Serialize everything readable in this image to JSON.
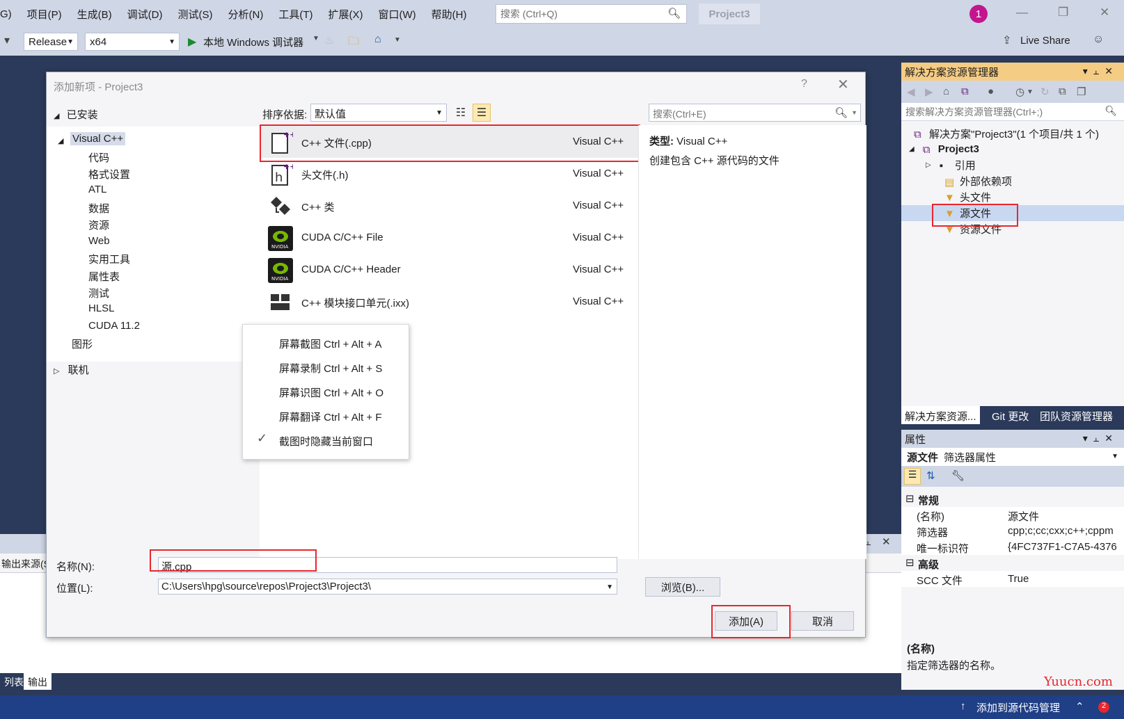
{
  "menubar": {
    "items": [
      "G)",
      "项目(P)",
      "生成(B)",
      "调试(D)",
      "测试(S)",
      "分析(N)",
      "工具(T)",
      "扩展(X)",
      "窗口(W)",
      "帮助(H)"
    ],
    "search_placeholder": "搜索 (Ctrl+Q)",
    "project_name": "Project3",
    "notification_count": "1"
  },
  "toolbar": {
    "config": "Release",
    "platform": "x64",
    "debugger": "本地 Windows 调试器",
    "live_share": "Live Share"
  },
  "dialog": {
    "title": "添加新项 - Project3",
    "help": "?",
    "installed": "已安装",
    "online": "联机",
    "tree": {
      "root": "Visual C++",
      "children": [
        "代码",
        "格式设置",
        "ATL",
        "数据",
        "资源",
        "Web",
        "实用工具",
        "属性表",
        "测试",
        "HLSL",
        "CUDA 11.2"
      ],
      "graphics": "图形"
    },
    "sort_label": "排序依据:",
    "sort_value": "默认值",
    "search_placeholder": "搜索(Ctrl+E)",
    "templates": [
      {
        "name": "C++ 文件(.cpp)",
        "lang": "Visual C++",
        "icon": "cpp-file-icon"
      },
      {
        "name": "头文件(.h)",
        "lang": "Visual C++",
        "icon": "header-file-icon"
      },
      {
        "name": "C++ 类",
        "lang": "Visual C++",
        "icon": "cpp-class-icon"
      },
      {
        "name": "CUDA C/C++ File",
        "lang": "Visual C++",
        "icon": "nvidia-icon"
      },
      {
        "name": "CUDA C/C++ Header",
        "lang": "Visual C++",
        "icon": "nvidia-icon"
      },
      {
        "name": "C++ 模块接口单元(.ixx)",
        "lang": "Visual C++",
        "icon": "module-icon"
      }
    ],
    "desc_type_label": "类型:",
    "desc_type_value": "Visual C++",
    "desc_text": "创建包含 C++ 源代码的文件",
    "name_label": "名称(N):",
    "name_value": "源.cpp",
    "location_label": "位置(L):",
    "location_value": "C:\\Users\\hpg\\source\\repos\\Project3\\Project3\\",
    "browse": "浏览(B)...",
    "add": "添加(A)",
    "cancel": "取消"
  },
  "context_menu": {
    "items": [
      "屏幕截图 Ctrl + Alt + A",
      "屏幕录制 Ctrl + Alt + S",
      "屏幕识图 Ctrl + Alt + O",
      "屏幕翻译 Ctrl + Alt + F",
      "截图时隐藏当前窗口"
    ]
  },
  "solution_explorer": {
    "title": "解决方案资源管理器",
    "search_placeholder": "搜索解决方案资源管理器(Ctrl+;)",
    "solution": "解决方案\"Project3\"(1 个项目/共 1 个)",
    "project": "Project3",
    "nodes": [
      "引用",
      "外部依赖项",
      "头文件",
      "源文件",
      "资源文件"
    ],
    "tabs": [
      "解决方案资源...",
      "Git 更改",
      "团队资源管理器"
    ]
  },
  "properties": {
    "title": "属性",
    "object_name": "源文件",
    "object_type": "筛选器属性",
    "categories": [
      "常规",
      "高级"
    ],
    "rows_general": [
      {
        "k": "(名称)",
        "v": "源文件"
      },
      {
        "k": "筛选器",
        "v": "cpp;c;cc;cxx;c++;cppm"
      },
      {
        "k": "唯一标识符",
        "v": "{4FC737F1-C7A5-4376"
      }
    ],
    "rows_advanced": [
      {
        "k": "SCC 文件",
        "v": "True"
      }
    ],
    "desc_title": "(名称)",
    "desc_text": "指定筛选器的名称。"
  },
  "output": {
    "source_label": "输出来源(S",
    "tabs": [
      "列表",
      "输出"
    ]
  },
  "statusbar": {
    "text": "添加到源代码管理",
    "badge": "2"
  },
  "watermark": "Yuucn.com",
  "colors": {
    "accent_title": "#f5cc84",
    "highlight_red": "#e8262d",
    "status_blue": "#1f3f86",
    "chrome": "#cfd6e5"
  }
}
